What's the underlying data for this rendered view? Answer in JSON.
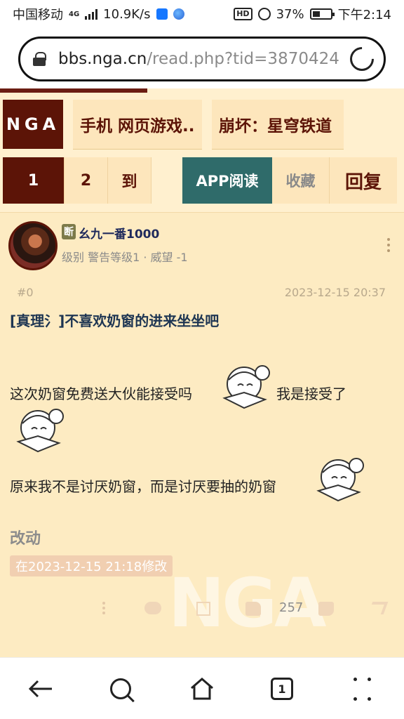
{
  "status_bar": {
    "carrier": "中国移动",
    "network": "4G",
    "speed": "10.9K/s",
    "hd": "HD",
    "battery": "37%",
    "time": "下午2:14"
  },
  "browser": {
    "url_host": "bbs.nga.cn",
    "url_path": "/read.php?tid=3870424"
  },
  "nav": {
    "logo": "NGA",
    "tab1": "手机 网页游戏..",
    "tab2": "崩坏：星穹铁道"
  },
  "pager": {
    "current": "1",
    "next": "2",
    "goto": "到",
    "app_read": "APP阅读",
    "favorite": "收藏",
    "reply": "回复"
  },
  "post": {
    "badge": "断",
    "username": "幺九一番1000",
    "level": "级别 警告等级1 · 威望 -1",
    "floor": "#0",
    "time": "2023-12-15 20:37",
    "title": "[真理氵]不喜欢奶窗的进来坐坐吧",
    "line1": "这次奶窗免费送大伙能接受吗",
    "line1b": "我是接受了",
    "line2": "原来我不是讨厌奶窗，而是讨厌要抽的奶窗",
    "edit_title": "改动",
    "edit_note": "在2023-12-15 21:18修改",
    "like_count": "257",
    "watermark": "NGA"
  },
  "bottom_nav": {
    "tab_count": "1"
  },
  "colors": {
    "brand": "#5c1407",
    "app_button": "#2f6b6a",
    "page_bg": "#fff0cf"
  }
}
